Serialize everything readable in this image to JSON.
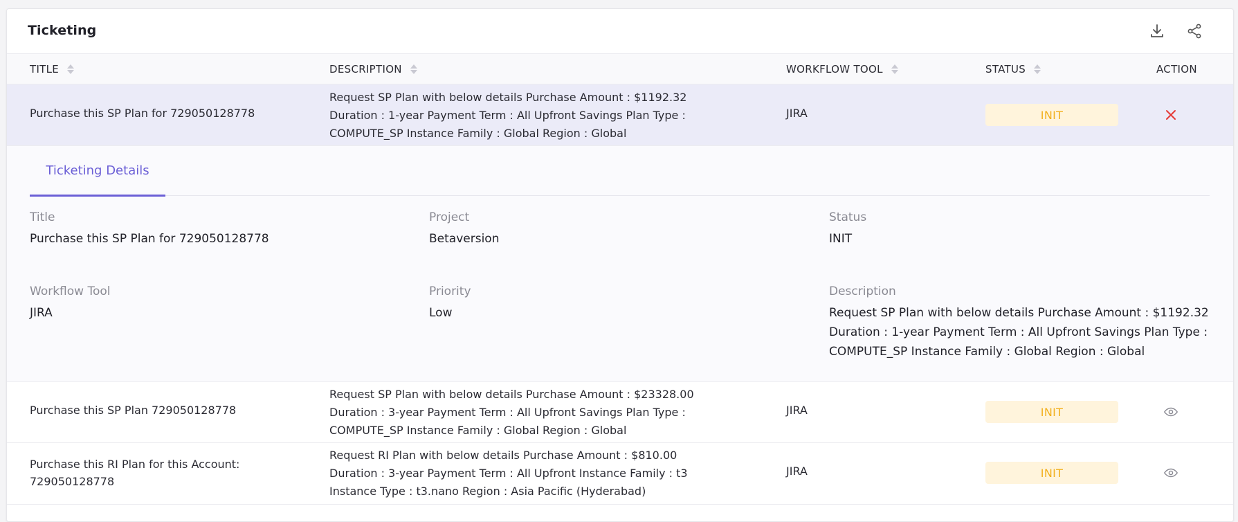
{
  "title": "Ticketing",
  "header_icons": [
    "download-icon",
    "share-icon"
  ],
  "columns": {
    "title": "TITLE",
    "description": "DESCRIPTION",
    "workflow_tool": "WORKFLOW TOOL",
    "status": "STATUS",
    "action": "ACTION"
  },
  "rows": [
    {
      "title": "Purchase this SP Plan for 729050128778",
      "description_lines": [
        "Request SP Plan with below details Purchase Amount : $1192.32",
        "Duration : 1-year Payment Term : All Upfront Savings Plan Type :",
        "COMPUTE_SP Instance Family : Global Region : Global"
      ],
      "workflow_tool": "JIRA",
      "status": "INIT",
      "action_icon": "close-icon",
      "expanded": true
    },
    {
      "title": "Purchase this SP Plan 729050128778",
      "description_lines": [
        "Request SP Plan with below details Purchase Amount : $23328.00",
        "Duration : 3-year Payment Term : All Upfront Savings Plan Type :",
        "COMPUTE_SP Instance Family : Global Region : Global"
      ],
      "workflow_tool": "JIRA",
      "status": "INIT",
      "action_icon": "eye-icon"
    },
    {
      "title_lines": [
        "Purchase this RI Plan for this Account:",
        "729050128778"
      ],
      "description_lines": [
        "Request RI Plan with below details Purchase Amount : $810.00",
        "Duration : 3-year Payment Term : All Upfront Instance Family : t3",
        "Instance Type : t3.nano Region : Asia Pacific (Hyderabad)"
      ],
      "workflow_tool": "JIRA",
      "status": "INIT",
      "action_icon": "eye-icon"
    }
  ],
  "details": {
    "tab_label": "Ticketing Details",
    "title_label": "Title",
    "title_value": "Purchase this SP Plan for 729050128778",
    "project_label": "Project",
    "project_value": "Betaversion",
    "status_label": "Status",
    "status_value": "INIT",
    "workflow_label": "Workflow Tool",
    "workflow_value": "JIRA",
    "priority_label": "Priority",
    "priority_value": "Low",
    "description_label": "Description",
    "description_lines": [
      "Request SP Plan with below details Purchase Amount : $1192.32",
      "Duration : 1-year Payment Term : All Upfront Savings Plan Type :",
      "COMPUTE_SP Instance Family : Global Region : Global"
    ]
  },
  "colors": {
    "accent": "#6b5fd6",
    "status_text": "#f2b01e",
    "status_bg": "#fff4dc",
    "selected_row_bg": "#ebebf8",
    "close_icon": "#e53935"
  }
}
